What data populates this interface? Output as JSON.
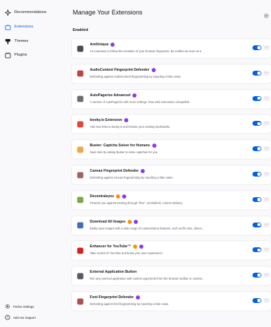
{
  "sidebar": {
    "items": [
      {
        "label": "Recommendations",
        "icon": "sparkle-icon"
      },
      {
        "label": "Extensions",
        "icon": "puzzle-icon",
        "active": true
      },
      {
        "label": "Themes",
        "icon": "brush-icon"
      },
      {
        "label": "Plugins",
        "icon": "plugin-icon"
      }
    ],
    "footer": [
      {
        "label": "Firefox Settings",
        "icon": "gear-icon"
      },
      {
        "label": "Add-ons Support",
        "icon": "help-icon"
      }
    ]
  },
  "main": {
    "title": "Manage Your Extensions",
    "section_label": "Enabled",
    "extensions": [
      {
        "name": "AmIUnique",
        "badges": [
          "purple"
        ],
        "desc": "An extension to follow the evolution of your browser fingerprint. Be notified as soon as a",
        "icon_color": "#4a4a55"
      },
      {
        "name": "AudioContext Fingerprint Defender",
        "badges": [
          "purple"
        ],
        "desc": "Defending against AudioContext fingerprinting by reporting a fake value.",
        "icon_color": "#c2423c"
      },
      {
        "name": "AutoPagerize Advanced",
        "badges": [
          "purple"
        ],
        "desc": "A version of AutoPagerize with more settings. Now web extensions compatible.",
        "icon_color": "#6b6b70"
      },
      {
        "name": "booky.io Extension",
        "badges": [
          "purple"
        ],
        "desc": "Add new links to booky.io and browse your existing bookmarks.",
        "icon_color": "#e0443a"
      },
      {
        "name": "Buster: Captcha Solver for Humans",
        "badges": [
          "purple"
        ],
        "desc": "Save time by asking Buster to solve captchas for you.",
        "icon_color": "#f0a64a"
      },
      {
        "name": "Canvas Fingerprint Defender",
        "badges": [
          "purple"
        ],
        "desc": "Defending against canvas fingerprinting by reporting a fake value.",
        "icon_color": "#a86060"
      },
      {
        "name": "Decentraleyes",
        "badges": [
          "orange",
          "purple"
        ],
        "desc": "Protects you against tracking through \"free\", centralized, content delivery.",
        "icon_color": "#7aa84a"
      },
      {
        "name": "Download All Images",
        "badges": [
          "orange",
          "purple"
        ],
        "desc": "Easily save images with a wide range of customization features, such as file size, dimen...",
        "icon_color": "#3f6fb5"
      },
      {
        "name": "Enhancer for YouTube™",
        "badges": [
          "orange",
          "purple"
        ],
        "desc": "Take control of YouTube and boost your user experience!",
        "icon_color": "#d0231f"
      },
      {
        "name": "External Application Button",
        "badges": [],
        "desc": "Run any external application with custom arguments from the browser toolbar or context...",
        "icon_color": "#5a5a66"
      },
      {
        "name": "Font Fingerprint Defender",
        "badges": [
          "purple"
        ],
        "desc": "Defending against font fingerprinting by reporting a fake value.",
        "icon_color": "#b05050"
      }
    ],
    "more_label": "···"
  },
  "colors": {
    "accent": "#0061e0",
    "badge_purple": "#8b3ae8",
    "badge_orange": "#ff9100"
  }
}
